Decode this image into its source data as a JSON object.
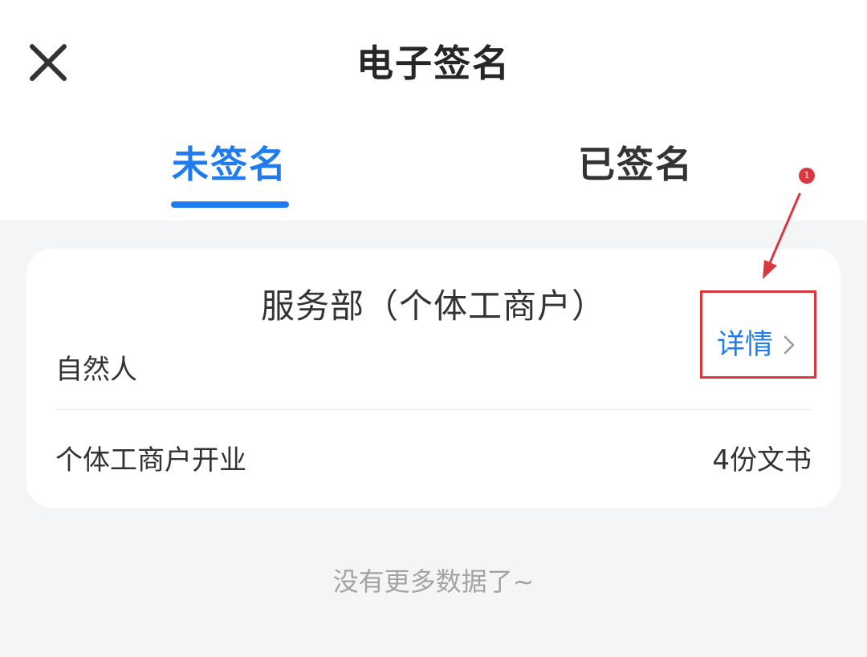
{
  "header": {
    "title": "电子签名",
    "close_icon": "close-icon"
  },
  "tabs": [
    {
      "label": "未签名",
      "active": true
    },
    {
      "label": "已签名",
      "active": false
    }
  ],
  "card": {
    "title": "服务部（个体工商户）",
    "subtitle": "自然人",
    "detail_label": "详情",
    "detail_icon": "chevron-right-icon",
    "business_type": "个体工商户开业",
    "doc_count": "4份文书"
  },
  "footer": {
    "no_more_text": "没有更多数据了~"
  },
  "annotation": {
    "step": "1",
    "color": "#d9383f"
  },
  "colors": {
    "accent": "#1f7cf0",
    "background": "#f4f5f7",
    "card": "#ffffff"
  }
}
